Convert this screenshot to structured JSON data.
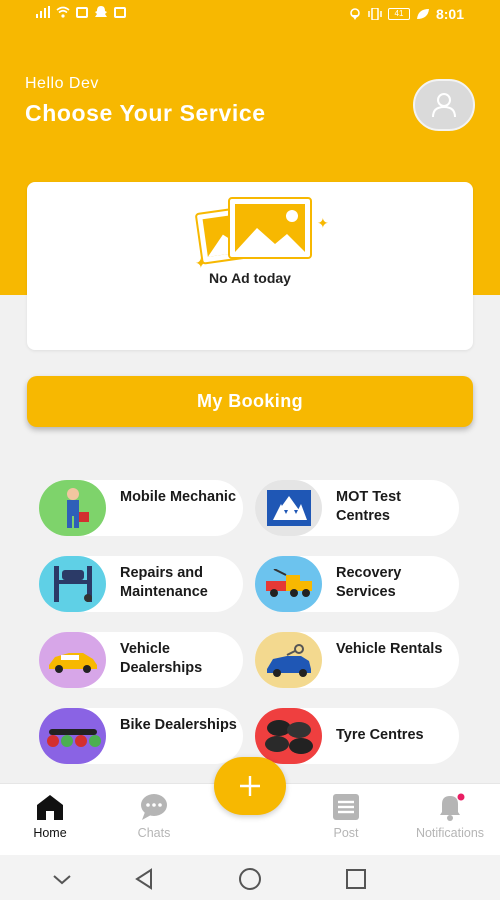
{
  "status_bar": {
    "time": "8:01",
    "battery": "41",
    "left_icons": [
      "signal-icon",
      "wifi-icon",
      "mail-icon",
      "snapchat-icon",
      "instagram-icon"
    ],
    "right_icons": [
      "location-icon",
      "vibrate-icon",
      "battery-icon",
      "leaf-icon"
    ]
  },
  "header": {
    "greeting": "Hello Dev",
    "title": "Choose Your Service",
    "avatar_icon": "user-icon"
  },
  "ad": {
    "text": "No Ad today",
    "icon": "image-placeholder-icon"
  },
  "booking": {
    "label": "My Booking"
  },
  "services": [
    {
      "label": "Mobile Mechanic",
      "icon": "mechanic-icon",
      "bg": "#7ed36b"
    },
    {
      "label": "MOT Test Centres",
      "icon": "mot-logo-icon",
      "bg": "#e5e5e5"
    },
    {
      "label": "Repairs and Maintenance",
      "icon": "car-lift-icon",
      "bg": "#5fd0e6"
    },
    {
      "label": "Recovery Services",
      "icon": "tow-truck-icon",
      "bg": "#6cc3ee"
    },
    {
      "label": "Vehicle Dealerships",
      "icon": "sports-car-icon",
      "bg": "#d7a6e8"
    },
    {
      "label": "Vehicle Rentals",
      "icon": "car-key-icon",
      "bg": "#f3d98f"
    },
    {
      "label": "Bike Dealerships",
      "icon": "motorbikes-icon",
      "bg": "#8a63e4"
    },
    {
      "label": "Tyre Centres",
      "icon": "tyres-icon",
      "bg": "#ef3f3f"
    }
  ],
  "bottom_nav": {
    "items": [
      {
        "label": "Home",
        "icon": "home-icon"
      },
      {
        "label": "Chats",
        "icon": "chat-icon"
      },
      {
        "label": "Post",
        "icon": "post-icon"
      },
      {
        "label": "Notifications",
        "icon": "bell-icon"
      }
    ],
    "fab_icon": "plus-icon"
  },
  "system_nav": [
    "down-icon",
    "back-icon",
    "home-circle-icon",
    "recents-icon"
  ],
  "colors": {
    "accent": "#f7b801",
    "background": "#f1f1f1",
    "card": "#ffffff",
    "notification_dot": "#e91e63"
  }
}
